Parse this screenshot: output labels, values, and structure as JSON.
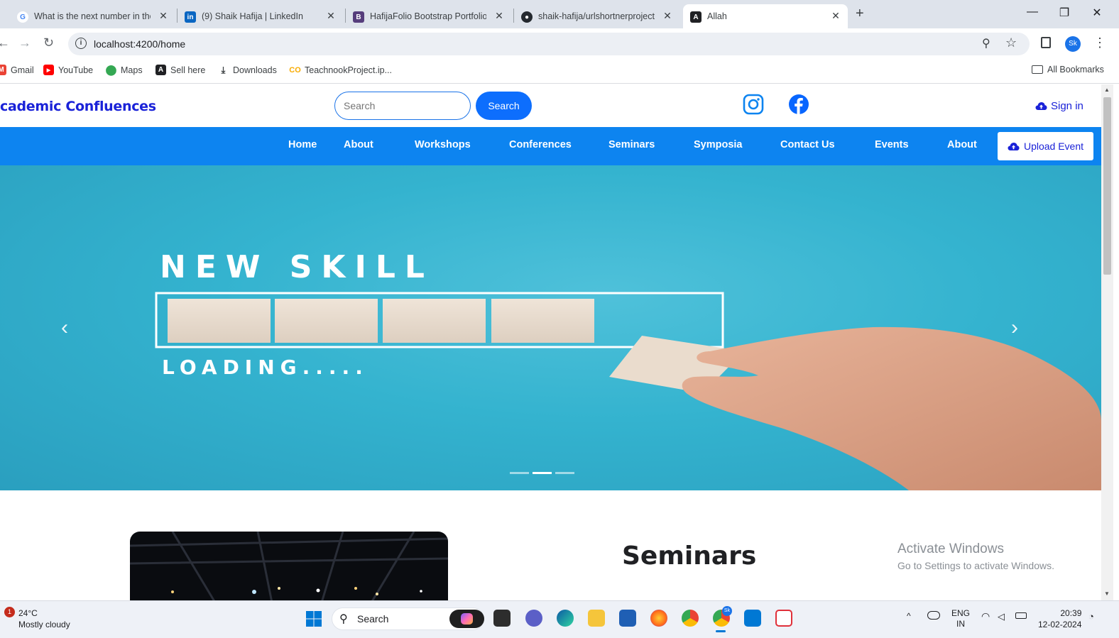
{
  "browser": {
    "tabs": [
      {
        "title": "What is the next number in the",
        "favicon": "google-icon"
      },
      {
        "title": "(9) Shaik Hafija | LinkedIn",
        "favicon": "linkedin-icon"
      },
      {
        "title": "HafijaFolio Bootstrap Portfolio T",
        "favicon": "bootstrap-icon"
      },
      {
        "title": "shaik-hafija/urlshortnerproject",
        "favicon": "github-icon"
      },
      {
        "title": "Allah",
        "favicon": "angular-icon"
      }
    ],
    "new_tab": "+",
    "url": "localhost:4200/home",
    "profile_initials": "Sk",
    "bookmarks": [
      {
        "label": "Gmail",
        "icon": "gmail-icon"
      },
      {
        "label": "YouTube",
        "icon": "youtube-icon"
      },
      {
        "label": "Maps",
        "icon": "maps-icon"
      },
      {
        "label": "Sell here",
        "icon": "angular-icon"
      },
      {
        "label": "Downloads",
        "icon": "download-icon"
      },
      {
        "label": "TeachnookProject.ip...",
        "icon": "colab-icon"
      }
    ],
    "all_bookmarks": "All Bookmarks"
  },
  "site": {
    "brand": "cademic Confluences",
    "search_placeholder": "Search",
    "search_button": "Search",
    "sign_in": "Sign in",
    "nav": [
      "Home",
      "About",
      "Workshops",
      "Conferences",
      "Seminars",
      "Symposia",
      "Contact Us",
      "Events",
      "About"
    ],
    "upload_button": "Upload Event",
    "carousel": {
      "slide_text_top": "NEW SKILL",
      "slide_text_bottom": "LOADING.....",
      "active_indicator": 2,
      "indicator_count": 3
    },
    "section_title": "Seminars"
  },
  "overlay": {
    "activate_title": "Activate Windows",
    "activate_sub": "Go to Settings to activate Windows."
  },
  "taskbar": {
    "weather_temp": "24°C",
    "weather_desc": "Mostly cloudy",
    "weather_badge": "1",
    "search_label": "Search",
    "lang_top": "ENG",
    "lang_bottom": "IN",
    "time": "20:39",
    "date": "12-02-2024",
    "chrome_badge": "Sk"
  },
  "colors": {
    "nav_blue": "#0d84f0",
    "brand_text": "#1a22d8",
    "button_blue": "#0d6efd",
    "carousel_teal": "#34b3cf"
  }
}
